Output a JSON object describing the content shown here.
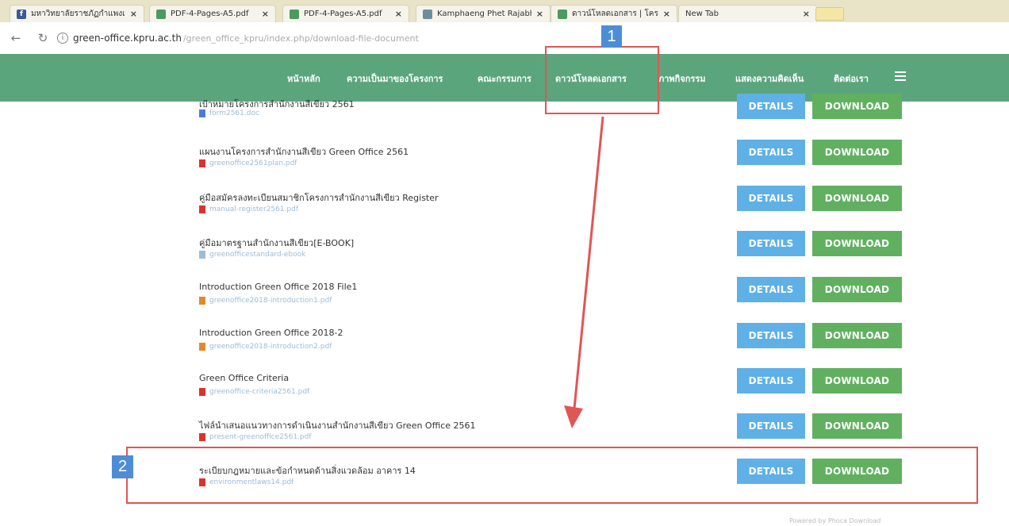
{
  "tabs": [
    {
      "title": "มหาวิทยาลัยราชภัฏกำแพงเพ...",
      "icon": "facebook-icon",
      "icon_color": "#3b5998"
    },
    {
      "title": "PDF-4-Pages-A5.pdf",
      "icon": "chrome-icon",
      "icon_color": "#4c9a5f"
    },
    {
      "title": "PDF-4-Pages-A5.pdf",
      "icon": "chrome-icon",
      "icon_color": "#4c9a5f"
    },
    {
      "title": "Kamphaeng Phet Rajabh...",
      "icon": "globe-icon",
      "icon_color": "#6b8e9e"
    },
    {
      "title": "ดาวน์โหลดเอกสาร | โครงก...",
      "icon": "chrome-icon",
      "icon_color": "#4c9a5f"
    },
    {
      "title": "New Tab",
      "icon": "",
      "icon_color": ""
    }
  ],
  "address": {
    "host": "green-office.kpru.ac.th",
    "path": "/green_office_kpru/index.php/download-file-document"
  },
  "nav": {
    "items": [
      "หน้าหลัก",
      "ความเป็นมาของโครงการ",
      "คณะกรรมการ",
      "ดาวน์โหลดเอกสาร",
      "ภาพกิจกรรม",
      "แสดงความคิดเห็น",
      "ติดต่อเรา"
    ]
  },
  "documents": [
    {
      "title": "เป้าหมายโครงการสำนักงานสีเขียว 2561",
      "file": "form2561.doc",
      "icon_color": "#4a7fd4"
    },
    {
      "title": "แผนงานโครงการสำนักงานสีเขียว Green Office 2561",
      "file": "greenoffice2561plan.pdf",
      "icon_color": "#d9342b"
    },
    {
      "title": "คู่มือสมัครลงทะเบียนสมาชิกโครงการสำนักงานสีเขียว Register",
      "file": "manual-register2561.pdf",
      "icon_color": "#d9342b"
    },
    {
      "title": "คู่มือมาตรฐานสำนักงานสีเขียว[E-BOOK]",
      "file": "greenofficestandard-ebook",
      "icon_color": "#9cbcd8"
    },
    {
      "title": "Introduction Green Office 2018 File1",
      "file": "greenoffice2018-introduction1.pdf",
      "icon_color": "#e08a2a"
    },
    {
      "title": "Introduction Green Office 2018-2",
      "file": "greenoffice2018-introduction2.pdf",
      "icon_color": "#e08a2a"
    },
    {
      "title": "Green Office Criteria",
      "file": "greenoffice-criteria2561.pdf",
      "icon_color": "#d9342b"
    },
    {
      "title": "ไฟล์นำเสนอแนวทางการดำเนินงานสำนักงานสีเขียว Green Office 2561",
      "file": "present-greenoffice2561.pdf",
      "icon_color": "#d9342b"
    },
    {
      "title": "ระเบียบกฎหมายและข้อกำหนดด้านสิ่งแวดล้อม อาคาร 14",
      "file": "environmentlaws14.pdf",
      "icon_color": "#d9342b"
    }
  ],
  "buttons": {
    "details": "DETAILS",
    "download": "DOWNLOAD"
  },
  "annotations": {
    "badge1": "1",
    "badge2": "2"
  },
  "footer": {
    "text": "Powered by Phoca Download"
  },
  "colors": {
    "navbar": "#5ba57d",
    "details": "#5eb0e6",
    "download": "#60b060",
    "annotation": "#e05555",
    "badge": "#4e8dd6"
  }
}
